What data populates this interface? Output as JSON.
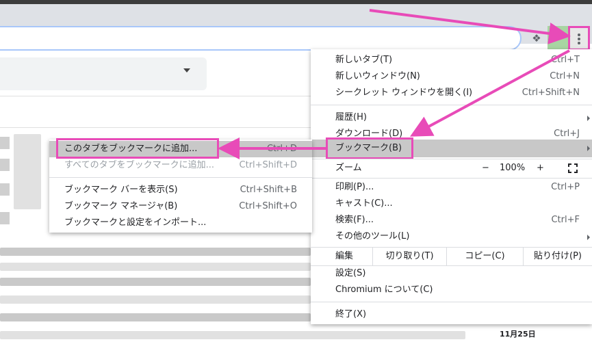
{
  "colors": {
    "highlight": "#e84bb8",
    "menu_hover": "#c8c8c8"
  },
  "toolbar": {
    "extension_icon": "puzzle-icon",
    "menu_icon": "three-dots-vertical-icon"
  },
  "menu": {
    "new_tab": {
      "label": "新しいタブ(T)",
      "shortcut": "Ctrl+T"
    },
    "new_window": {
      "label": "新しいウィンドウ(N)",
      "shortcut": "Ctrl+N"
    },
    "incognito": {
      "label": "シークレット ウィンドウを開く(I)",
      "shortcut": "Ctrl+Shift+N"
    },
    "history": {
      "label": "履歴(H)"
    },
    "downloads": {
      "label": "ダウンロード(D)",
      "shortcut": "Ctrl+J"
    },
    "bookmarks": {
      "label": "ブックマーク(B)"
    },
    "zoom": {
      "label": "ズーム",
      "minus": "−",
      "value": "100%",
      "plus": "+"
    },
    "print": {
      "label": "印刷(P)...",
      "shortcut": "Ctrl+P"
    },
    "cast": {
      "label": "キャスト(C)..."
    },
    "find": {
      "label": "検索(F)...",
      "shortcut": "Ctrl+F"
    },
    "more_tools": {
      "label": "その他のツール(L)"
    },
    "edit": {
      "label": "編集",
      "cut": "切り取り(T)",
      "copy": "コピー(C)",
      "paste": "貼り付け(P)"
    },
    "settings": {
      "label": "設定(S)"
    },
    "about": {
      "label": "Chromium について(C)"
    },
    "exit": {
      "label": "終了(X)"
    }
  },
  "submenu": {
    "add_tab": {
      "label": "このタブをブックマークに追加...",
      "shortcut": "Ctrl+D"
    },
    "add_all_tabs": {
      "label": "すべてのタブをブックマークに追加...",
      "shortcut": "Ctrl+Shift+D"
    },
    "show_bar": {
      "label": "ブックマーク バーを表示(S)",
      "shortcut": "Ctrl+Shift+B"
    },
    "manager": {
      "label": "ブックマーク マネージャ(B)",
      "shortcut": "Ctrl+Shift+O"
    },
    "import": {
      "label": "ブックマークと設定をインポート..."
    }
  },
  "background": {
    "date": "11月25日"
  }
}
